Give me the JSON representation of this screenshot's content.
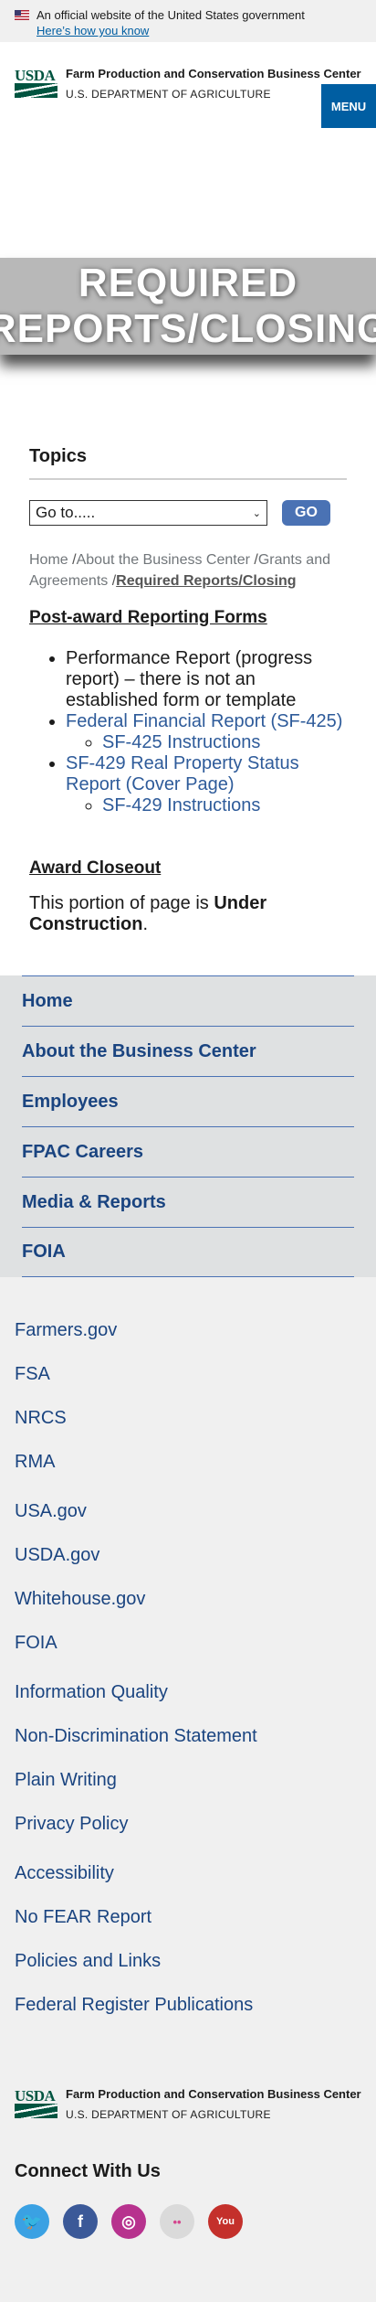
{
  "gov_banner": {
    "text": "An official website of the United States government",
    "link": "Here’s how you know"
  },
  "header": {
    "logo_text": "USDA",
    "agency_name": "Farm Production and Conservation Business Center",
    "department": "U.S. DEPARTMENT OF AGRICULTURE",
    "menu_label": "MENU"
  },
  "hero": {
    "title": "REQUIRED REPORTS/CLOSING"
  },
  "topics": {
    "title": "Topics",
    "select_value": "Go to.....",
    "go_label": "GO"
  },
  "breadcrumb": {
    "items": [
      "Home",
      "About the Business Center",
      "Grants and Agreements",
      "Required Reports/Closing"
    ]
  },
  "content": {
    "post_award_title": "Post-award Reporting Forms",
    "items": [
      "Performance Report (progress report) – there is not an established form or template",
      "Federal Financial Report (SF-425)",
      "SF-425 Instructions",
      "SF-429 Real Property Status Report (Cover Page)",
      "SF-429 Instructions"
    ],
    "closeout_title": "Award Closeout",
    "construction_prefix": "This portion of page is ",
    "construction_bold": "Under Construction",
    "construction_suffix": "."
  },
  "footer_nav": [
    "Home",
    "About the Business Center",
    "Employees",
    "FPAC Careers",
    "Media & Reports",
    "FOIA"
  ],
  "footer_links": {
    "group1": [
      "Farmers.gov",
      "FSA",
      "NRCS",
      "RMA"
    ],
    "group2": [
      "USA.gov",
      "USDA.gov",
      "Whitehouse.gov",
      "FOIA"
    ],
    "group3": [
      "Information Quality",
      "Non-Discrimination Statement",
      "Plain Writing",
      "Privacy Policy"
    ],
    "group4": [
      "Accessibility",
      "No FEAR Report",
      "Policies and Links",
      "Federal Register Publications"
    ]
  },
  "connect": {
    "title": "Connect With Us",
    "icons": [
      {
        "name": "twitter-icon",
        "glyph": "🐦",
        "color": "#3aa1e3"
      },
      {
        "name": "facebook-icon",
        "glyph": "f",
        "color": "#3b5998"
      },
      {
        "name": "instagram-icon",
        "glyph": "◎",
        "color": "#b7328e"
      },
      {
        "name": "flickr-icon",
        "glyph": "••",
        "color": "#dadada"
      },
      {
        "name": "youtube-icon",
        "glyph": "You",
        "color": "#c4302b"
      }
    ]
  },
  "colors": {
    "accent": "#005ea2",
    "link": "#1a4480",
    "go_button": "#4a72b4",
    "hero": "#b8b8b8"
  }
}
